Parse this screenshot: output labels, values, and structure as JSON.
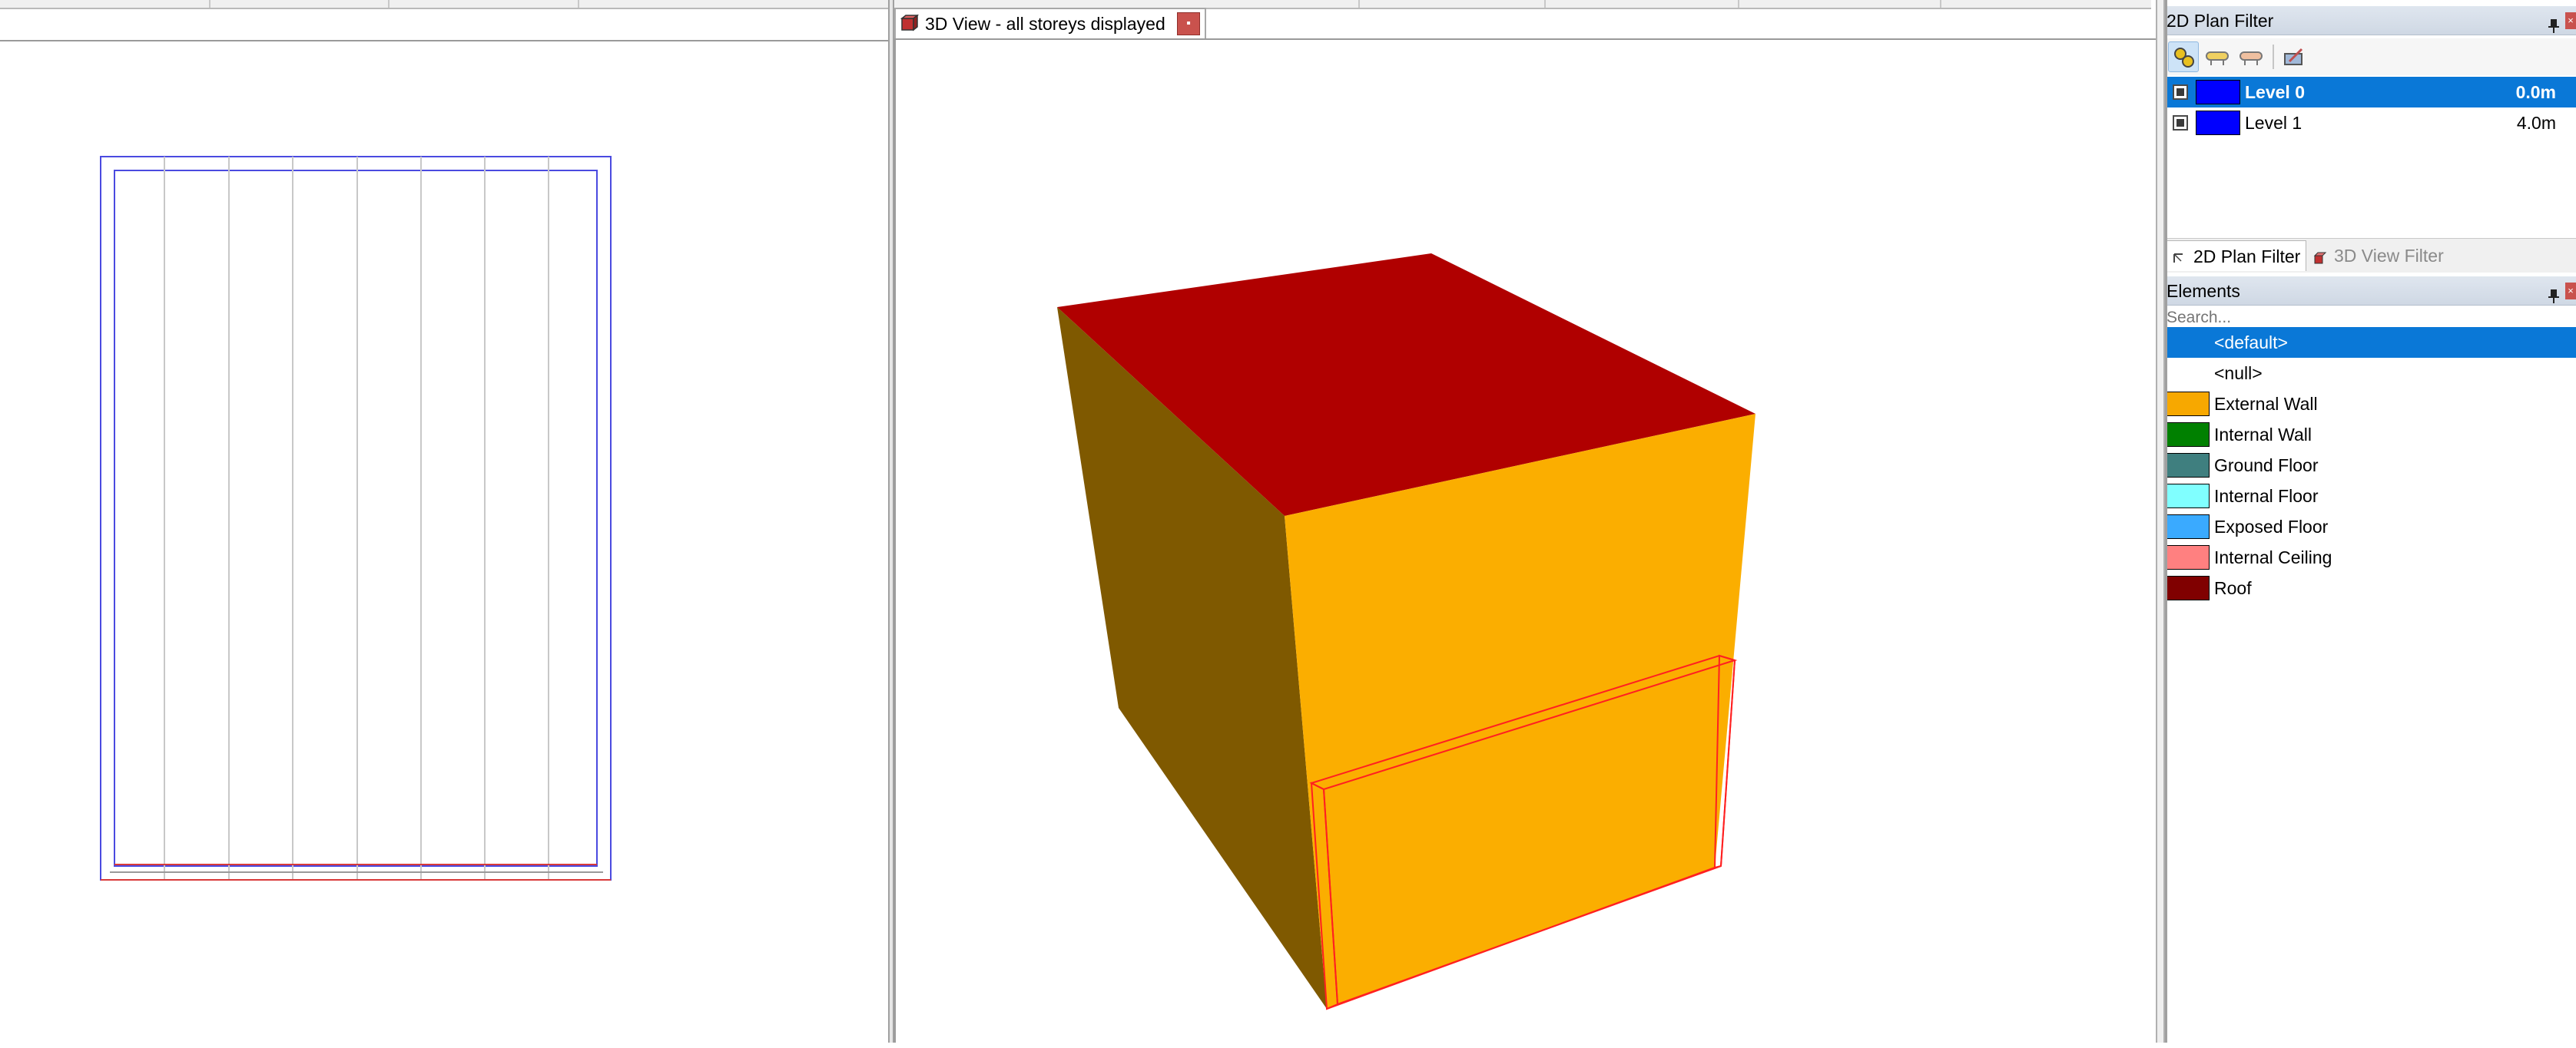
{
  "view_tab": {
    "title": "3D View - all storeys displayed",
    "close_glyph": "▪"
  },
  "plan_filter": {
    "title": "2D Plan Filter",
    "toolbar_icons": [
      "filter-all-icon",
      "filter-above-icon",
      "filter-below-icon",
      "filter-edit-icon"
    ],
    "levels": [
      {
        "name": "Level 0",
        "elevation": "0.0m",
        "color": "#0000ff",
        "selected": true
      },
      {
        "name": "Level 1",
        "elevation": "4.0m",
        "color": "#0000ff",
        "selected": false
      }
    ],
    "tabs": [
      {
        "label": "2D Plan Filter",
        "active": true
      },
      {
        "label": "3D View Filter",
        "active": false
      }
    ]
  },
  "elements": {
    "title": "Elements",
    "search_placeholder": "Search...",
    "items": [
      {
        "name": "<default>",
        "color": "",
        "selected": true
      },
      {
        "name": "<null>",
        "color": "",
        "selected": false
      },
      {
        "name": "External Wall",
        "color": "#f7a800",
        "selected": false
      },
      {
        "name": "Internal Wall",
        "color": "#008000",
        "selected": false
      },
      {
        "name": "Ground Floor",
        "color": "#3f7f7f",
        "selected": false
      },
      {
        "name": "Internal Floor",
        "color": "#80ffff",
        "selected": false
      },
      {
        "name": "Exposed Floor",
        "color": "#3aaaff",
        "selected": false
      },
      {
        "name": "Internal Ceiling",
        "color": "#ff8080",
        "selected": false
      },
      {
        "name": "Roof",
        "color": "#800000",
        "selected": false
      }
    ]
  },
  "model_colors": {
    "roof": "#b00000",
    "wall_lit": "#fbae00",
    "wall_shaded": "#7f5900",
    "outline": "#ff2020",
    "plan_outline": "#4a4ae0",
    "plan_section": "#d83a3a",
    "plan_grid": "#c8c8c8"
  }
}
